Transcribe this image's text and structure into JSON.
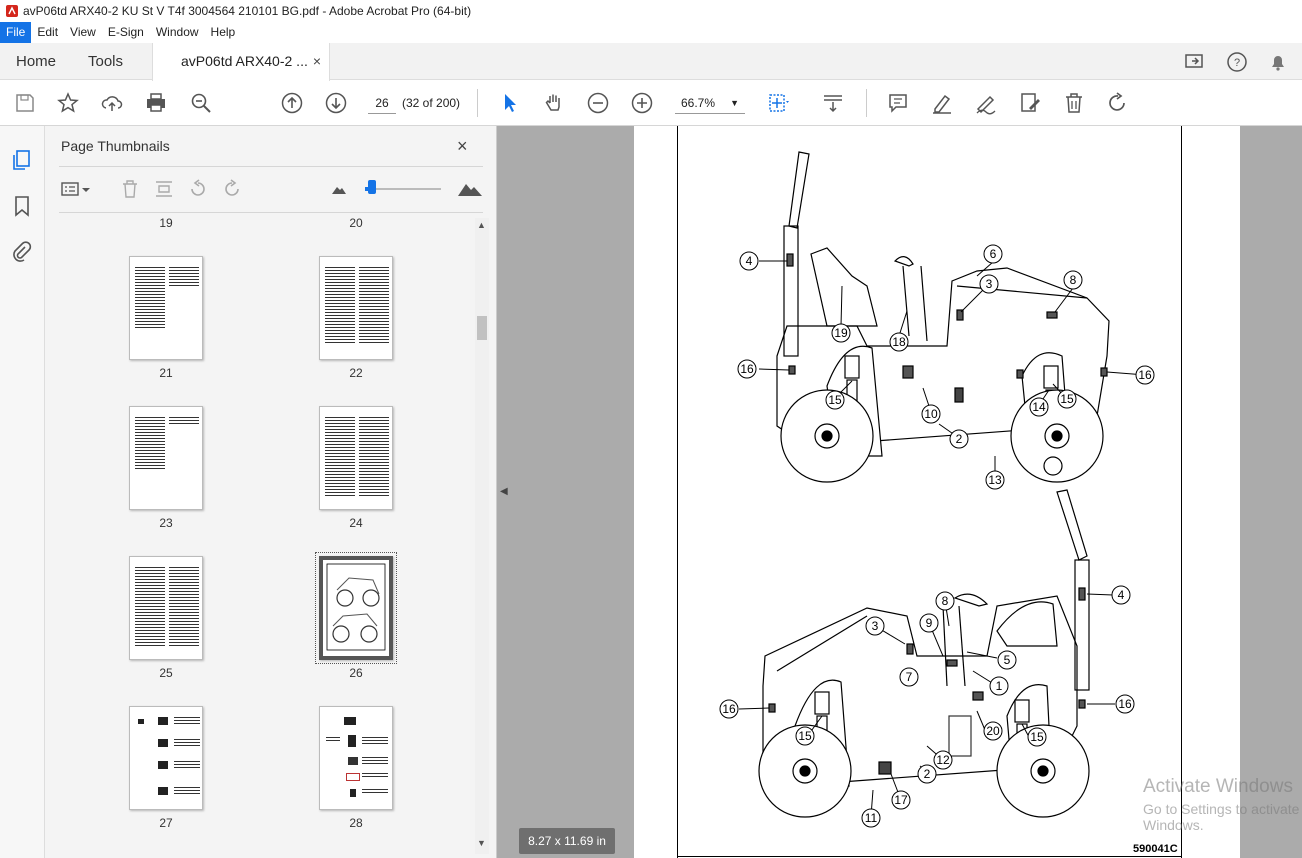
{
  "window": {
    "title": "avP06td ARX40-2 KU St V T4f 3004564 210101 BG.pdf - Adobe Acrobat Pro (64-bit)"
  },
  "menu": [
    "File",
    "Edit",
    "View",
    "E-Sign",
    "Window",
    "Help"
  ],
  "tabs": {
    "home": "Home",
    "tools": "Tools",
    "doc": "avP06td ARX40-2 ...",
    "close": "×"
  },
  "toolbar": {
    "page_number": "26",
    "page_count": "(32 of 200)",
    "zoom": "66.7%"
  },
  "panel": {
    "title": "Page Thumbnails",
    "close": "×",
    "top_labels": [
      "19",
      "20"
    ],
    "pages": [
      "21",
      "22",
      "23",
      "24",
      "25",
      "26",
      "27",
      "28"
    ],
    "selected_page": "26"
  },
  "document": {
    "page_size": "8.27 x 11.69 in",
    "drawing_code": "590041C",
    "callouts_top": [
      "4",
      "6",
      "3",
      "8",
      "19",
      "18",
      "16",
      "15",
      "10",
      "2",
      "14",
      "15",
      "16",
      "13"
    ],
    "callouts_bottom": [
      "4",
      "3",
      "9",
      "8",
      "5",
      "7",
      "1",
      "16",
      "15",
      "20",
      "15",
      "16",
      "12",
      "2",
      "17",
      "11"
    ]
  },
  "watermark": {
    "line1": "Activate Windows",
    "line2": "Go to Settings to activate Windows."
  }
}
